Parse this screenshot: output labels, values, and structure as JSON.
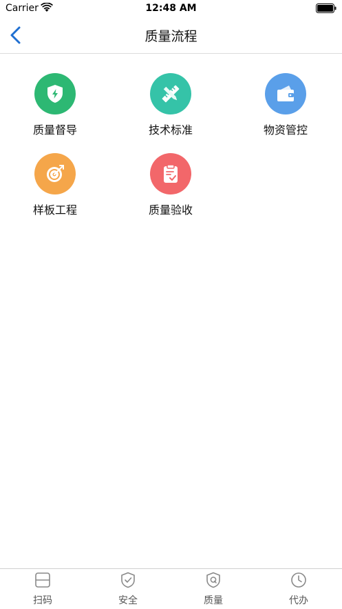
{
  "status_bar": {
    "carrier": "Carrier",
    "time": "12:48 AM"
  },
  "nav": {
    "title": "质量流程",
    "back_icon": "chevron-left-icon"
  },
  "menu": [
    {
      "label": "质量督导",
      "icon": "shield-bolt-icon",
      "color": "#2db873"
    },
    {
      "label": "技术标准",
      "icon": "ruler-pencil-icon",
      "color": "#35c3a8"
    },
    {
      "label": "物资管控",
      "icon": "wallet-icon",
      "color": "#5a9fe9"
    },
    {
      "label": "样板工程",
      "icon": "target-icon",
      "color": "#f5a64a"
    },
    {
      "label": "质量验收",
      "icon": "clipboard-check-icon",
      "color": "#f2676a"
    }
  ],
  "tabs": [
    {
      "label": "扫码",
      "icon": "scan-icon"
    },
    {
      "label": "安全",
      "icon": "shield-check-icon"
    },
    {
      "label": "质量",
      "icon": "quality-shield-icon"
    },
    {
      "label": "代办",
      "icon": "clock-icon"
    }
  ],
  "colors": {
    "accent": "#1f6fd1",
    "tab_icon": "#888888"
  }
}
